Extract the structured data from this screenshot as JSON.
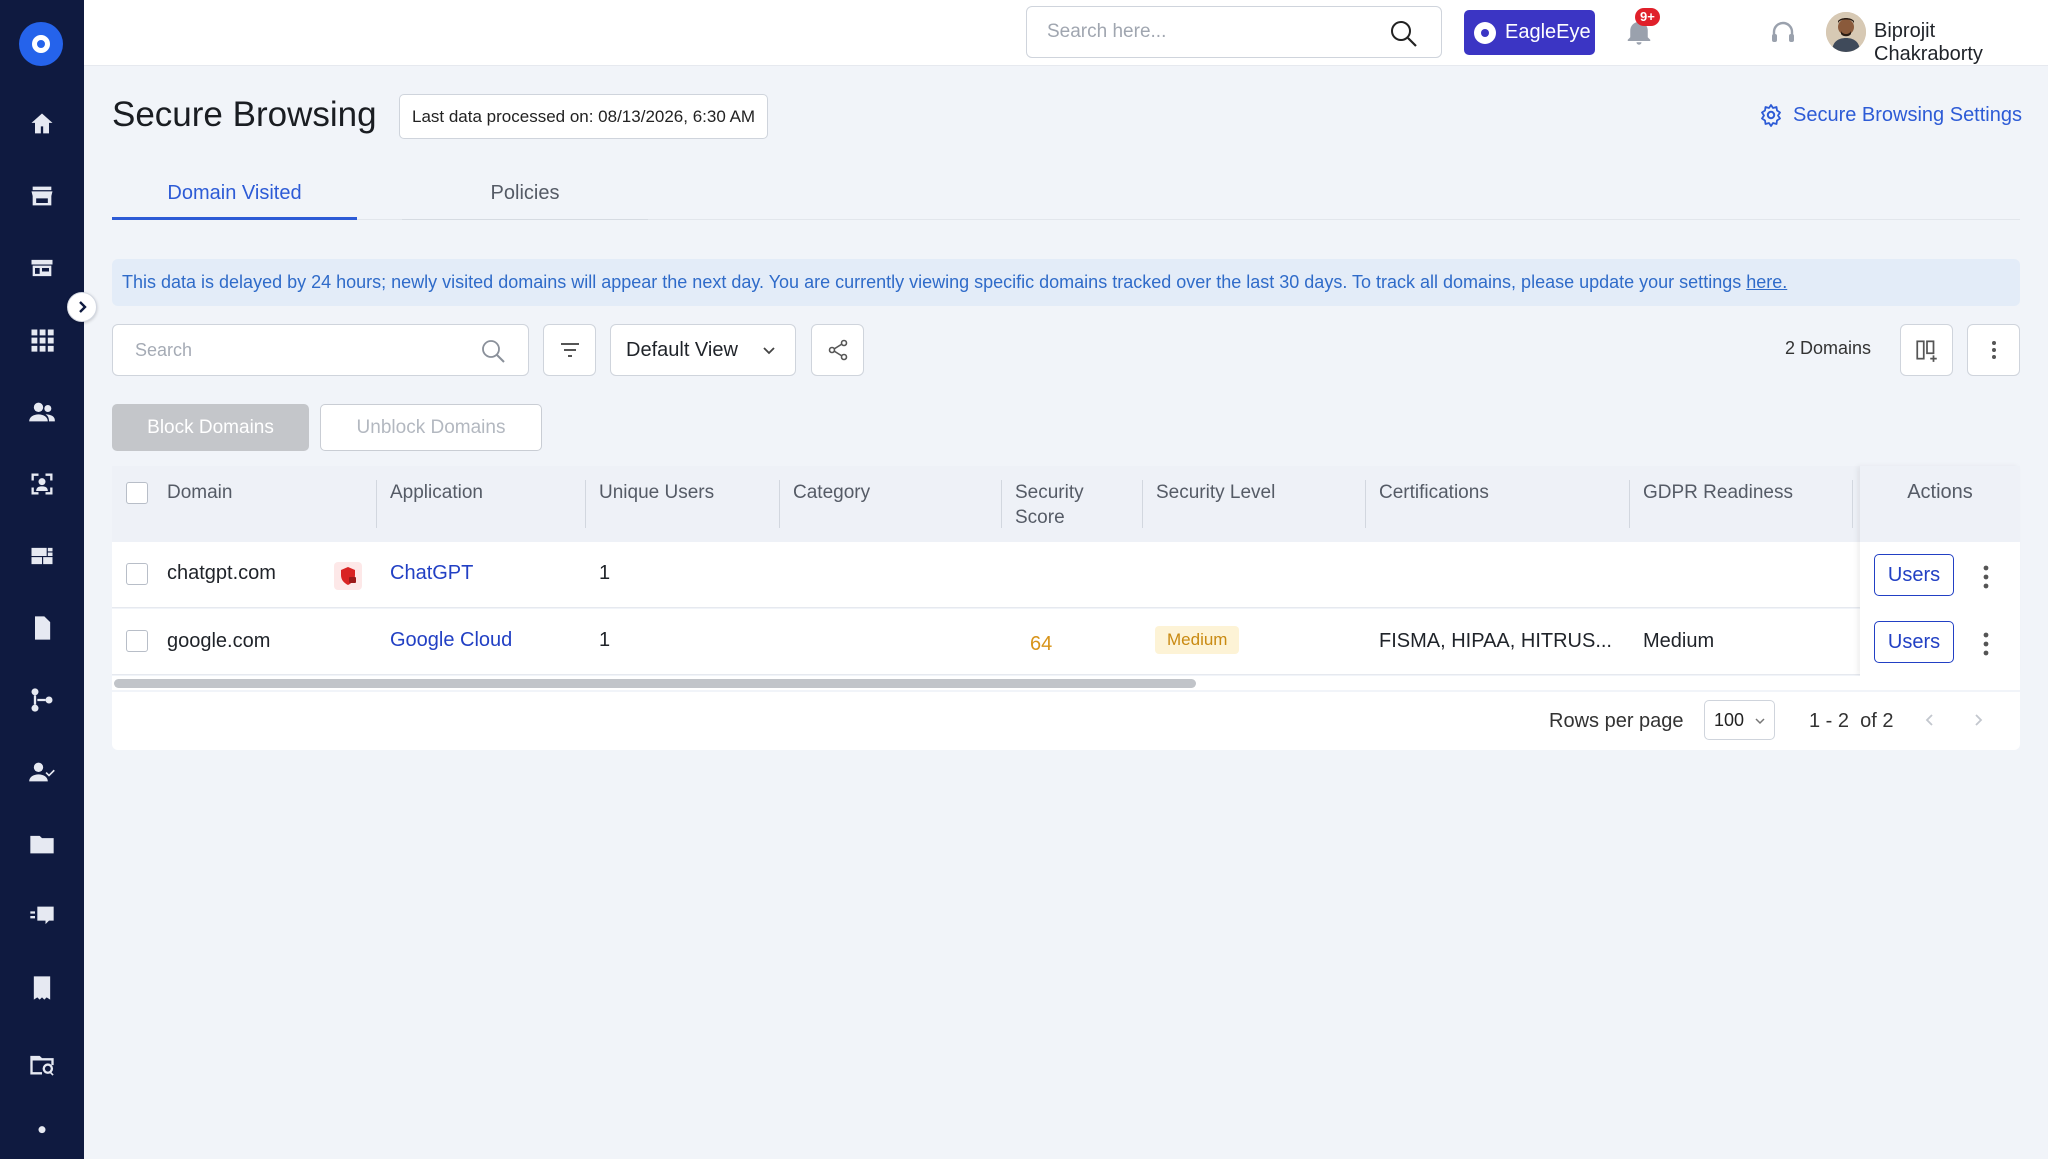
{
  "topbar": {
    "search_placeholder": "Search here...",
    "eagleeye_label": "EagleEye",
    "notification_badge": "9+",
    "user_name": "Biprojit Chakraborty"
  },
  "header": {
    "title": "Secure Browsing",
    "last_processed": "Last data processed on: 08/13/2026, 6:30 AM",
    "settings_link": "Secure Browsing Settings"
  },
  "tabs": [
    {
      "label": "Domain Visited",
      "active": true
    },
    {
      "label": "Policies",
      "active": false
    }
  ],
  "banner": {
    "text": "This data is delayed by 24 hours; newly visited domains will appear the next day. You are currently viewing specific domains tracked over the last 30 days. To track all domains, please update your settings ",
    "link": "here."
  },
  "toolbar": {
    "search_placeholder": "Search",
    "view_selected": "Default View",
    "domains_count": "2 Domains",
    "block_label": "Block Domains",
    "unblock_label": "Unblock Domains"
  },
  "table": {
    "columns": [
      "Domain",
      "Application",
      "Unique Users",
      "Category",
      "Security Score",
      "Security Level",
      "Certifications",
      "GDPR Readiness",
      "Actions"
    ],
    "rows": [
      {
        "domain": "chatgpt.com",
        "application": "ChatGPT",
        "unique_users": "1",
        "category": "",
        "security_score": "",
        "security_level": "",
        "certifications": "",
        "gdpr": "",
        "action": "Users",
        "blocked_indicator": true
      },
      {
        "domain": "google.com",
        "application": "Google Cloud",
        "unique_users": "1",
        "category": "",
        "security_score": "64",
        "security_level": "Medium",
        "certifications": "FISMA, HIPAA, HITRUS...",
        "gdpr": "Medium",
        "action": "Users",
        "blocked_indicator": false
      }
    ]
  },
  "pagination": {
    "rows_per_page_label": "Rows per page",
    "rows_per_page": "100",
    "range": "1 - 2  of 2"
  },
  "colors": {
    "sidebar": "#0f1a40",
    "accent": "#2d5bd6",
    "eagleeye": "#3b35c4",
    "score": "#d8941a"
  }
}
